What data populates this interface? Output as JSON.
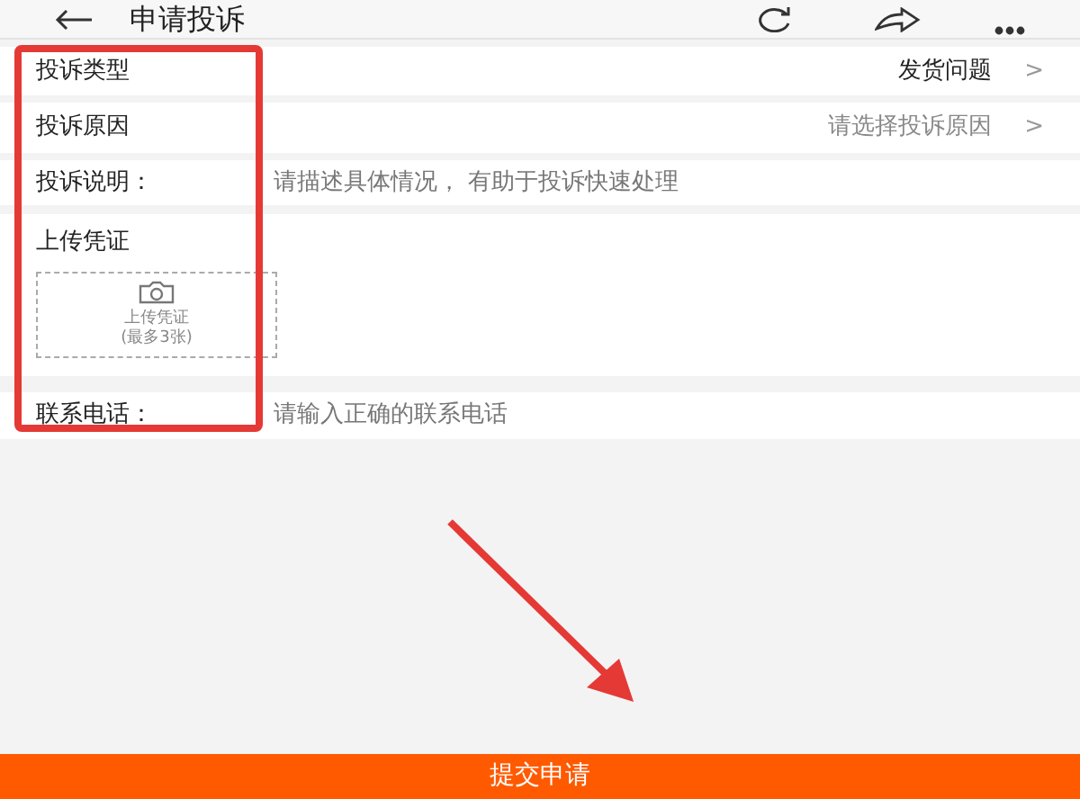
{
  "header": {
    "title": "申请投诉"
  },
  "form": [
    {
      "kind": "select",
      "label": "投诉类型",
      "value": "发货问题",
      "chevron": ">"
    },
    {
      "kind": "select",
      "label": "投诉原因",
      "placeholder": "请选择投诉原因",
      "chevron": ">"
    },
    {
      "kind": "text",
      "label": "投诉说明：",
      "placeholder": "请描述具体情况， 有助于投诉快速处理"
    },
    {
      "kind": "upload",
      "label": "上传凭证",
      "button_text": "上传凭证",
      "button_note": "(最多3张)"
    },
    {
      "kind": "text",
      "label": "联系电话：",
      "placeholder": "请输入正确的联系电话"
    }
  ],
  "submit": "提交申请",
  "highlight_box": true,
  "arrow": true
}
